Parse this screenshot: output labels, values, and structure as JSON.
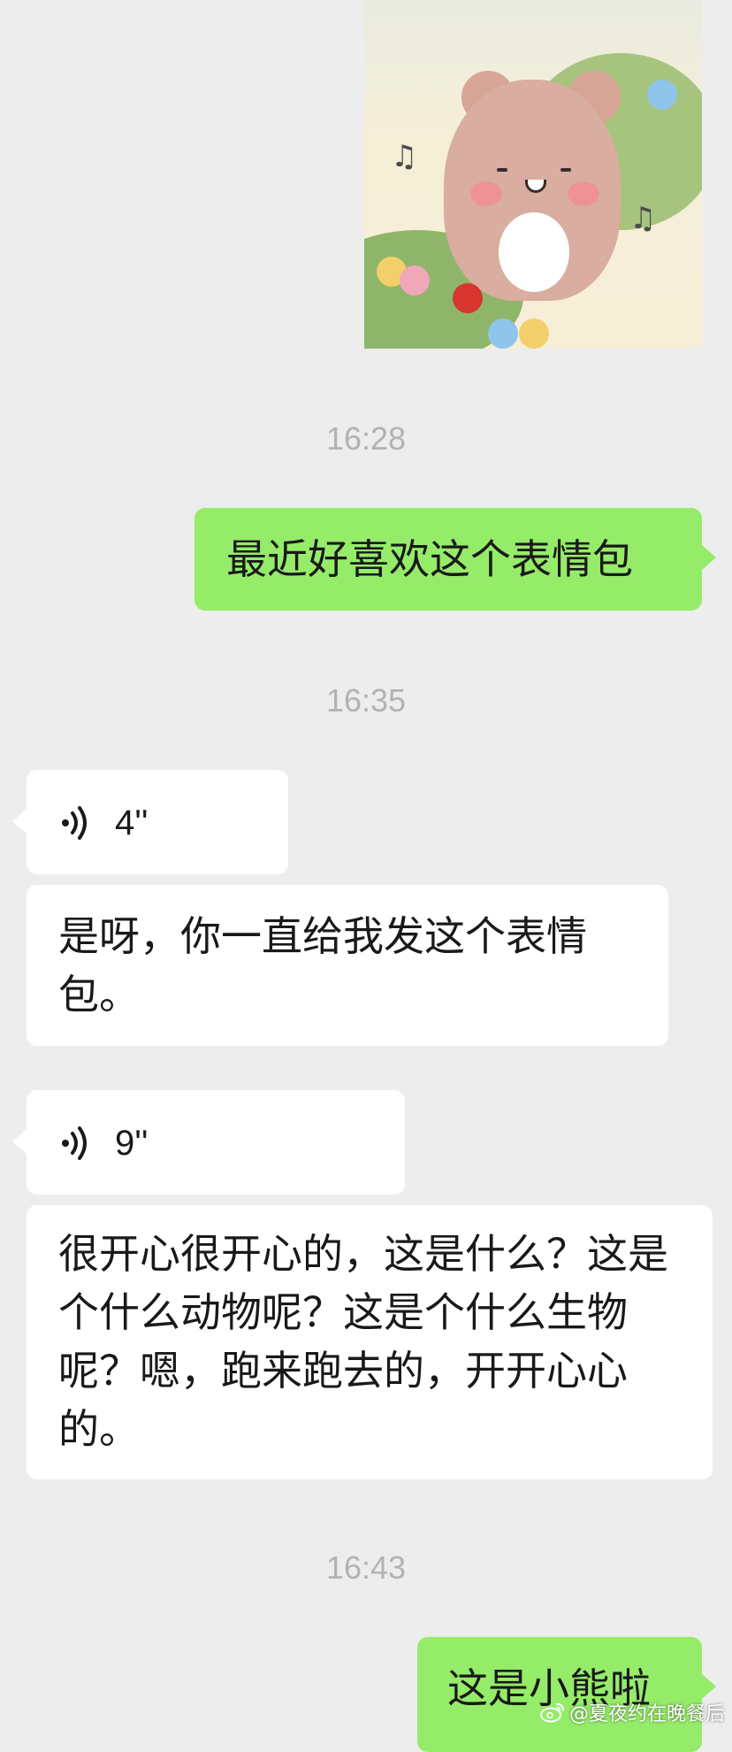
{
  "messages": {
    "sent_1": {
      "text": "最近好喜欢这个表情包"
    },
    "voice_1": {
      "duration": "4''"
    },
    "recv_1": {
      "text": "是呀，你一直给我发这个表情包。"
    },
    "voice_2": {
      "duration": "9''"
    },
    "recv_2": {
      "text": "很开心很开心的，这是什么？这是个什么动物呢？这是个什么生物呢？嗯，跑来跑去的，开开心心的。"
    },
    "sent_2": {
      "text": "这是小熊啦"
    }
  },
  "timestamps": {
    "t1": "16:28",
    "t2": "16:35",
    "t3": "16:43"
  },
  "watermark": {
    "text": "@夏夜约在晚餐后"
  },
  "colors": {
    "background": "#ededed",
    "sent_bubble": "#95ec69",
    "received_bubble": "#ffffff",
    "timestamp": "#b2b2b2"
  },
  "icons": {
    "voice": "voice-wave-icon",
    "watermark_logo": "weibo-logo-icon"
  }
}
